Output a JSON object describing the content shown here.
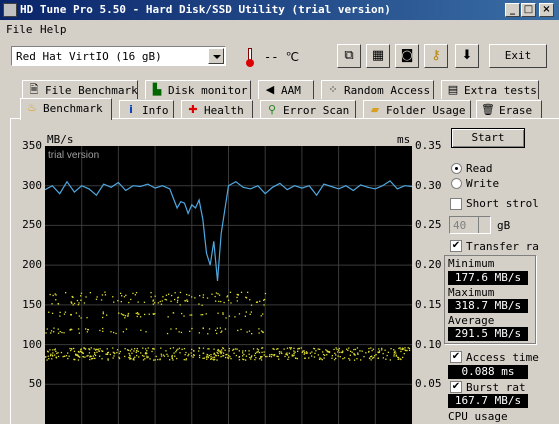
{
  "window": {
    "title": "HD Tune Pro 5.50 - Hard Disk/SSD Utility (trial version)",
    "controls": [
      "_",
      "□",
      "×"
    ]
  },
  "menu": [
    "File",
    "Help"
  ],
  "toolbar": {
    "drive": "Red Hat VirtIO (16 gB)",
    "temperature": "-- ℃",
    "icons": [
      "copy-text-icon",
      "copy-screenshot-icon",
      "camera-icon",
      "key-icon",
      "download-icon"
    ],
    "exit_label": "Exit"
  },
  "tabs_row1": [
    {
      "label": "File Benchmark",
      "icon": "file-benchmark-icon"
    },
    {
      "label": "Disk monitor",
      "icon": "disk-monitor-icon"
    },
    {
      "label": "AAM",
      "icon": "speaker-icon"
    },
    {
      "label": "Random Access",
      "icon": "random-access-icon"
    },
    {
      "label": "Extra tests",
      "icon": "extra-tests-icon"
    }
  ],
  "tabs_row2": [
    {
      "label": "Benchmark",
      "icon": "benchmark-icon",
      "active": true
    },
    {
      "label": "Info",
      "icon": "info-icon"
    },
    {
      "label": "Health",
      "icon": "health-icon"
    },
    {
      "label": "Error Scan",
      "icon": "magnifier-icon"
    },
    {
      "label": "Folder Usage",
      "icon": "folder-icon"
    },
    {
      "label": "Erase",
      "icon": "trash-icon"
    }
  ],
  "chart_data": {
    "type": "line",
    "watermark": "trial version",
    "ylabel_left": "MB/s",
    "ylabel_right": "ms",
    "y_left_ticks": [
      350,
      300,
      250,
      200,
      150,
      100,
      50
    ],
    "y_right_ticks": [
      "0.35",
      "0.30",
      "0.25",
      "0.20",
      "0.15",
      "0.10",
      "0.05"
    ],
    "ylim_left": [
      0,
      350
    ],
    "ylim_right": [
      0,
      0.35
    ],
    "grid": true,
    "transfer_rate": {
      "color": "#4fa8e0",
      "x": [
        0,
        2,
        4,
        6,
        8,
        10,
        12,
        14,
        16,
        18,
        20,
        22,
        24,
        26,
        28,
        30,
        32,
        34,
        35,
        36,
        37,
        38,
        39,
        40,
        41,
        42,
        43,
        44,
        45,
        46,
        47,
        48,
        50,
        52,
        54,
        56,
        58,
        60,
        62,
        64,
        66,
        68,
        70,
        72,
        74,
        76,
        78,
        80,
        82,
        84,
        86,
        88,
        90,
        92,
        94,
        96,
        98,
        100
      ],
      "y": [
        295,
        300,
        290,
        305,
        292,
        300,
        296,
        288,
        302,
        298,
        304,
        294,
        300,
        299,
        302,
        297,
        300,
        296,
        284,
        272,
        280,
        278,
        265,
        276,
        272,
        282,
        258,
        215,
        200,
        230,
        180,
        240,
        300,
        305,
        298,
        296,
        300,
        290,
        298,
        303,
        295,
        300,
        297,
        300,
        288,
        302,
        299,
        296,
        300,
        294,
        301,
        298,
        296,
        300,
        306,
        296,
        300,
        299
      ]
    },
    "access_time": {
      "color": "#e0e030",
      "bands_ms": [
        0.085,
        0.093,
        0.118,
        0.138,
        0.154,
        0.163
      ],
      "extent_percent": [
        100,
        100,
        60,
        60,
        60,
        60
      ]
    }
  },
  "controls": {
    "start_label": "Start",
    "read_label": "Read",
    "write_label": "Write",
    "read_selected": true,
    "short_stroke_label": "Short strol",
    "short_stroke_checked": false,
    "short_stroke_value": "40",
    "short_stroke_unit": "gB",
    "transfer_rate_label": "Transfer ra",
    "transfer_rate_checked": true,
    "minimum_label": "Minimum",
    "minimum_value": "177.6 MB/s",
    "maximum_label": "Maximum",
    "maximum_value": "318.7 MB/s",
    "average_label": "Average",
    "average_value": "291.5 MB/s",
    "access_time_label": "Access time",
    "access_time_checked": true,
    "access_time_value": "0.088 ms",
    "burst_rate_label": "Burst rat",
    "burst_rate_checked": true,
    "burst_rate_value": "167.7 MB/s",
    "cpu_usage_label": "CPU usage"
  }
}
